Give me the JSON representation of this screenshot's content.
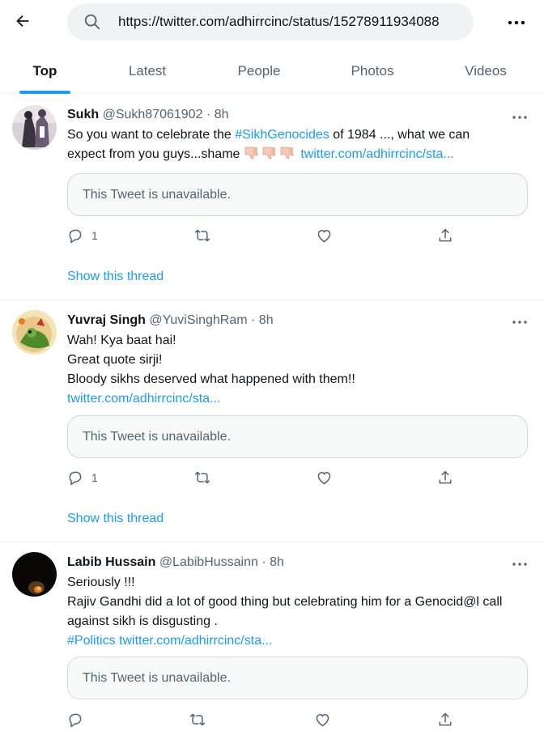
{
  "header": {
    "search_value": "https://twitter.com/adhirrcinc/status/15278911934088",
    "icons": [
      "back-arrow-icon",
      "search-icon",
      "more-icon"
    ]
  },
  "tabs": [
    {
      "label": "Top",
      "active": true
    },
    {
      "label": "Latest",
      "active": false
    },
    {
      "label": "People",
      "active": false
    },
    {
      "label": "Photos",
      "active": false
    },
    {
      "label": "Videos",
      "active": false
    }
  ],
  "tweets": [
    {
      "name": "Sukh",
      "handle": "@Sukh87061902",
      "time": "· 8h",
      "text_part1": "So you want to celebrate the ",
      "hashtag": "#SikhGenocides",
      "text_part2": " of 1984 ..., what we can",
      "text_line2": "expect from you guys...shame ",
      "emoji_icons": [
        "thumbs-down-icon",
        "thumbs-down-icon",
        "thumbs-down-icon"
      ],
      "link": "twitter.com/adhirrcinc/sta...",
      "quote": "This Tweet is unavailable.",
      "reply_count": "1",
      "show_thread": "Show this thread"
    },
    {
      "name": "Yuvraj Singh",
      "handle": "@YuviSinghRam",
      "time": "· 8h",
      "lines": [
        "Wah! Kya baat hai!",
        "Great quote sirji!",
        "Bloody sikhs deserved what happened with them!!"
      ],
      "link": "twitter.com/adhirrcinc/sta...",
      "quote": "This Tweet is unavailable.",
      "reply_count": "1",
      "show_thread": "Show this thread"
    },
    {
      "name": "Labib Hussain",
      "handle": "@LabibHussainn",
      "time": "· 8h",
      "lines": [
        "Seriously !!!",
        "Rajiv Gandhi did a lot of good thing but celebrating him for a  Genocid@l call",
        "against sikh is disgusting ."
      ],
      "hashtag": "#Politics",
      "link": "twitter.com/adhirrcinc/sta...",
      "quote": "This Tweet is unavailable."
    }
  ],
  "colors": {
    "accent": "#1d9bf0",
    "text": "#0f1419",
    "muted": "#536471",
    "border": "#eff3f4"
  }
}
